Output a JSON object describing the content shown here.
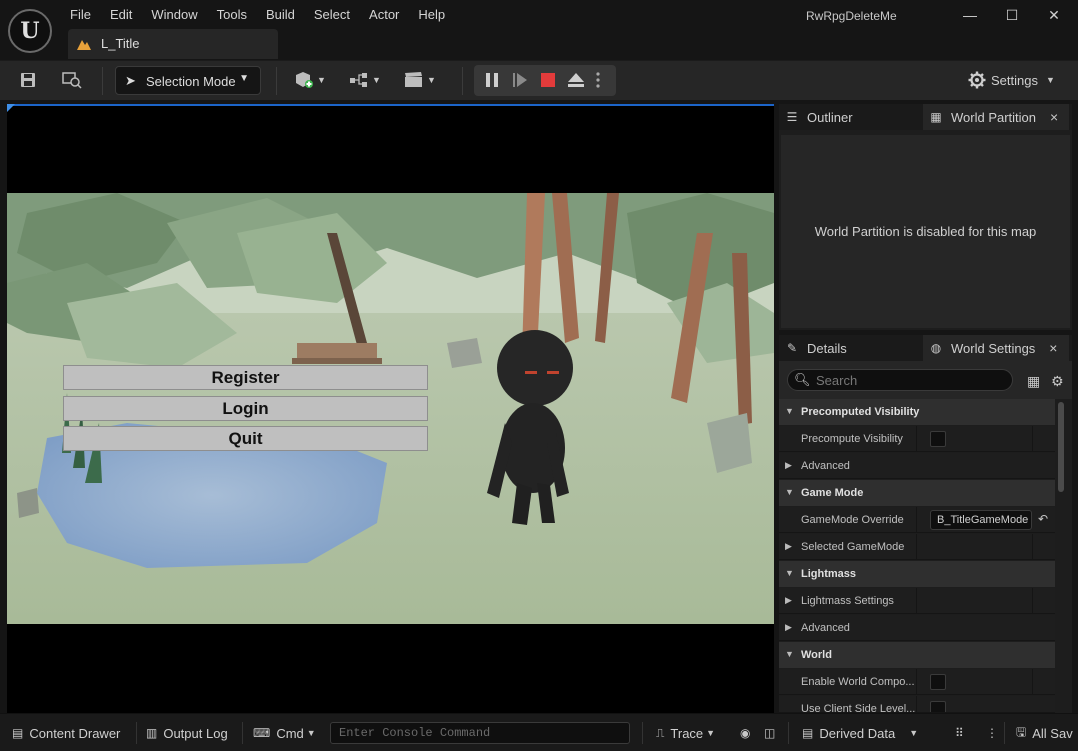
{
  "app": {
    "logo_text": "U",
    "project_name": "RwRpgDeleteMe",
    "menu": [
      "File",
      "Edit",
      "Window",
      "Tools",
      "Build",
      "Select",
      "Actor",
      "Help"
    ],
    "window_controls": {
      "minimize": "—",
      "maximize": "☐",
      "close": "✕"
    },
    "level_tab": "L_Title"
  },
  "toolbar": {
    "selection_mode_label": "Selection Mode",
    "settings_label": "Settings",
    "icons": [
      "save-icon",
      "browse-icon",
      "add-actor-icon",
      "blueprint-icon",
      "cinematics-icon",
      "pause-icon",
      "step-icon",
      "stop-icon",
      "eject-icon",
      "more-icon",
      "settings-icon"
    ],
    "accent_color": "#3f8fe8",
    "stop_color": "#e33b3b"
  },
  "viewport": {
    "menu_buttons": [
      "Register",
      "Login",
      "Quit"
    ]
  },
  "outliner": {
    "tabs": [
      {
        "label": "Outliner",
        "icon": "list-icon"
      },
      {
        "label": "World Partition",
        "icon": "world-partition-icon",
        "active": true,
        "close": "×"
      }
    ],
    "message": "World Partition is disabled for this map"
  },
  "details": {
    "tabs": [
      {
        "label": "Details",
        "icon": "pencil-icon"
      },
      {
        "label": "World Settings",
        "icon": "globe-icon",
        "active": true,
        "close": "×"
      }
    ],
    "search_placeholder": "Search",
    "rows": [
      {
        "type": "category",
        "label": "Precomputed Visibility"
      },
      {
        "type": "checkbox",
        "label": "Precompute Visibility"
      },
      {
        "type": "group",
        "label": "Advanced"
      },
      {
        "type": "category",
        "label": "Game Mode"
      },
      {
        "type": "combo",
        "label": "GameMode Override",
        "value": "B_TitleGameMode"
      },
      {
        "type": "group",
        "label": "Selected GameMode"
      },
      {
        "type": "category",
        "label": "Lightmass"
      },
      {
        "type": "group",
        "label": "Lightmass Settings"
      },
      {
        "type": "group",
        "label": "Advanced"
      },
      {
        "type": "category",
        "label": "World"
      },
      {
        "type": "checkbox",
        "label": "Enable World Compo..."
      },
      {
        "type": "checkbox",
        "label": "Use Client Side Level..."
      }
    ]
  },
  "statusbar": {
    "content_drawer": "Content Drawer",
    "output_log": "Output Log",
    "cmd": "Cmd",
    "console_placeholder": "Enter Console Command",
    "trace": "Trace",
    "derived_data": "Derived Data",
    "all_saved": "All Sav"
  }
}
